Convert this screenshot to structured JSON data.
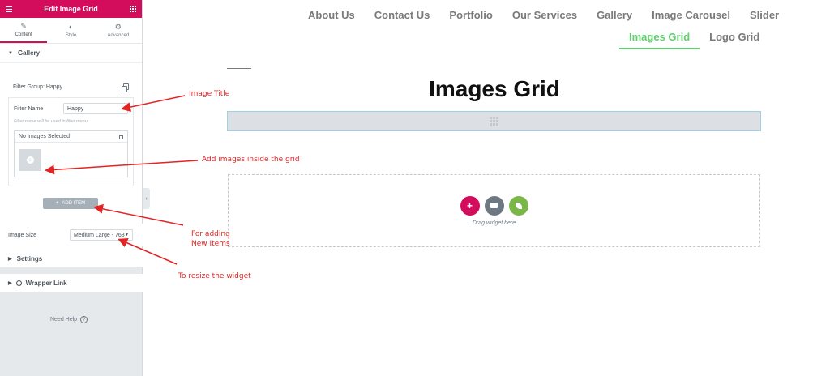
{
  "panel": {
    "title": "Edit Image Grid",
    "tabs": [
      {
        "label": "Content",
        "icon": "pencil-icon"
      },
      {
        "label": "Style",
        "icon": "contrast-icon"
      },
      {
        "label": "Advanced",
        "icon": "gear-icon"
      }
    ],
    "gallery_section": "Gallery",
    "filter_group_label": "Filter Group: Happy",
    "filter_name_label": "Filter Name",
    "filter_name_value": "Happy",
    "filter_name_desc": "Filter name will be used in filter menu.",
    "media_label": "No Images Selected",
    "add_item_label": "ADD ITEM",
    "image_size_label": "Image Size",
    "image_size_value": "Medium Large - 768",
    "settings_section": "Settings",
    "wrapper_link_section": "Wrapper Link",
    "need_help": "Need Help"
  },
  "nav": {
    "row1": [
      "About Us",
      "Contact Us",
      "Portfolio",
      "Our Services",
      "Gallery",
      "Image Carousel",
      "Slider"
    ],
    "row2": [
      "Images Grid",
      "Logo Grid"
    ],
    "active": "Images Grid",
    "active_color": "#61ce70"
  },
  "page": {
    "title": "Images Grid",
    "drop_text": "Drag widget here"
  },
  "annotations": {
    "image_title": "Image Title",
    "add_images": "Add images inside the grid",
    "for_adding": "For adding",
    "new_items": "New Items",
    "resize": "To resize the widget",
    "color": "#e52323"
  },
  "colors": {
    "brand": "#d30c5c",
    "panel_bg": "#e6e9ec",
    "happy_green": "#7ab648"
  }
}
